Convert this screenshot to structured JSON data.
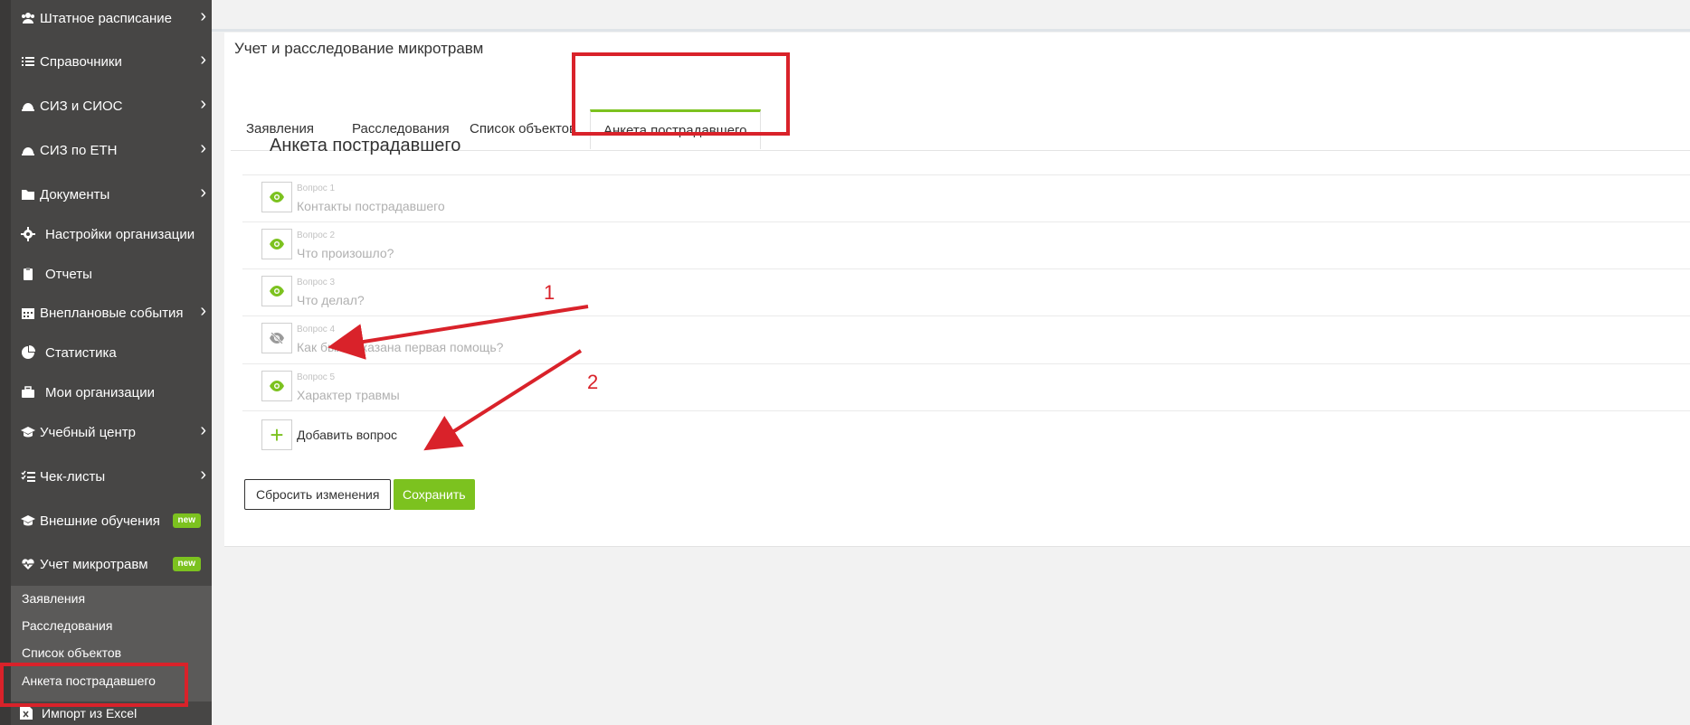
{
  "sidebar": {
    "items": [
      {
        "label": "Штатное расписание",
        "icon": "users-icon",
        "chevron": true
      },
      {
        "label": "Справочники",
        "icon": "list-icon",
        "chevron": true
      },
      {
        "label": "СИЗ и СИОС",
        "icon": "hardhat-icon",
        "chevron": true
      },
      {
        "label": "СИЗ по ЕТН",
        "icon": "hardhat-icon",
        "chevron": true
      },
      {
        "label": "Документы",
        "icon": "folder-icon",
        "chevron": true
      },
      {
        "label": "Настройки организации",
        "icon": "gear-icon",
        "chevron": false
      },
      {
        "label": "Отчеты",
        "icon": "clipboard-icon",
        "chevron": false
      },
      {
        "label": "Внеплановые события",
        "icon": "calendar-icon",
        "chevron": true
      },
      {
        "label": "Статистика",
        "icon": "pie-chart-icon",
        "chevron": false
      },
      {
        "label": "Мои организации",
        "icon": "briefcase-icon",
        "chevron": false
      },
      {
        "label": "Учебный центр",
        "icon": "graduation-cap-icon",
        "chevron": true
      },
      {
        "label": "Чек-листы",
        "icon": "checklist-icon",
        "chevron": true
      },
      {
        "label": "Внешние обучения",
        "icon": "graduation-cap-icon",
        "badge": "new"
      },
      {
        "label": "Учет микротравм",
        "icon": "heartbeat-icon",
        "badge": "new"
      }
    ],
    "chevron_glyph": "›",
    "submenu": [
      {
        "label": "Заявления"
      },
      {
        "label": "Расследования"
      },
      {
        "label": "Список объектов"
      },
      {
        "label": "Анкета пострадавшего"
      }
    ],
    "import_label": "Импорт из Excel"
  },
  "main": {
    "title": "Учет и расследование микротравм",
    "tabs": [
      {
        "label": "Заявления"
      },
      {
        "label": "Расследования"
      },
      {
        "label": "Список объектов"
      },
      {
        "label": "Анкета пострадавшего",
        "active": true
      }
    ],
    "section_title": "Анкета пострадавшего",
    "questions": [
      {
        "num": "Вопрос 1",
        "text": "Контакты пострадавшего",
        "visible": true
      },
      {
        "num": "Вопрос 2",
        "text": "Что произошло?",
        "visible": true
      },
      {
        "num": "Вопрос 3",
        "text": "Что делал?",
        "visible": true
      },
      {
        "num": "Вопрос 4",
        "text": "Как была оказана первая помощь?",
        "visible": false
      },
      {
        "num": "Вопрос 5",
        "text": "Характер травмы",
        "visible": true
      }
    ],
    "add_question_label": "Добавить вопрос",
    "add_glyph": "+",
    "reset_label": "Сбросить изменения",
    "save_label": "Сохранить"
  },
  "annotations": {
    "arrow1_label": "1",
    "arrow2_label": "2"
  },
  "colors": {
    "accent": "#7cc21f",
    "sidebar_bg": "#474645",
    "annotation_red": "#d9222a"
  }
}
